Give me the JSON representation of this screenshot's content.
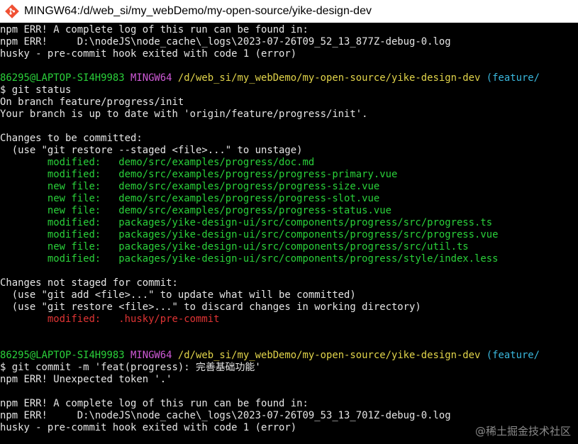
{
  "window": {
    "title": "MINGW64:/d/web_si/my_webDemo/my-open-source/yike-design-dev",
    "app_icon": "git-bash-icon",
    "colors": {
      "background": "#000000",
      "text": "#e6e6e6",
      "green": "#2ad13a",
      "magenta": "#d05ad8",
      "yellow": "#e1d44a",
      "cyan": "#3ab8de",
      "red": "#e03434"
    }
  },
  "terminal": {
    "lines": [
      {
        "segments": [
          {
            "text": "npm ERR! A complete log of this run can be found in:",
            "color": "default"
          }
        ]
      },
      {
        "segments": [
          {
            "text": "npm ERR!     D:\\nodeJS\\node_cache\\_logs\\2023-07-26T09_52_13_877Z-debug-0.log",
            "color": "default"
          }
        ]
      },
      {
        "segments": [
          {
            "text": "husky - pre-commit hook exited with code 1 (error)",
            "color": "default"
          }
        ]
      },
      {
        "segments": []
      },
      {
        "segments": [
          {
            "text": "86295@LAPTOP-SI4H9983 ",
            "color": "green"
          },
          {
            "text": "MINGW64 ",
            "color": "magenta"
          },
          {
            "text": "/d/web_si/my_webDemo/my-open-source/yike-design-dev ",
            "color": "yellow"
          },
          {
            "text": "(feature/",
            "color": "cyan"
          }
        ]
      },
      {
        "segments": [
          {
            "text": "$ git status",
            "color": "default"
          }
        ]
      },
      {
        "segments": [
          {
            "text": "On branch feature/progress/init",
            "color": "default"
          }
        ]
      },
      {
        "segments": [
          {
            "text": "Your branch is up to date with 'origin/feature/progress/init'.",
            "color": "default"
          }
        ]
      },
      {
        "segments": []
      },
      {
        "segments": [
          {
            "text": "Changes to be committed:",
            "color": "default"
          }
        ]
      },
      {
        "segments": [
          {
            "text": "  (use \"git restore --staged <file>...\" to unstage)",
            "color": "default"
          }
        ]
      },
      {
        "segments": [
          {
            "text": "        modified:   demo/src/examples/progress/doc.md",
            "color": "green"
          }
        ]
      },
      {
        "segments": [
          {
            "text": "        modified:   demo/src/examples/progress/progress-primary.vue",
            "color": "green"
          }
        ]
      },
      {
        "segments": [
          {
            "text": "        new file:   demo/src/examples/progress/progress-size.vue",
            "color": "green"
          }
        ]
      },
      {
        "segments": [
          {
            "text": "        new file:   demo/src/examples/progress/progress-slot.vue",
            "color": "green"
          }
        ]
      },
      {
        "segments": [
          {
            "text": "        new file:   demo/src/examples/progress/progress-status.vue",
            "color": "green"
          }
        ]
      },
      {
        "segments": [
          {
            "text": "        modified:   packages/yike-design-ui/src/components/progress/src/progress.ts",
            "color": "green"
          }
        ]
      },
      {
        "segments": [
          {
            "text": "        modified:   packages/yike-design-ui/src/components/progress/src/progress.vue",
            "color": "green"
          }
        ]
      },
      {
        "segments": [
          {
            "text": "        new file:   packages/yike-design-ui/src/components/progress/src/util.ts",
            "color": "green"
          }
        ]
      },
      {
        "segments": [
          {
            "text": "        modified:   packages/yike-design-ui/src/components/progress/style/index.less",
            "color": "green"
          }
        ]
      },
      {
        "segments": []
      },
      {
        "segments": [
          {
            "text": "Changes not staged for commit:",
            "color": "default"
          }
        ]
      },
      {
        "segments": [
          {
            "text": "  (use \"git add <file>...\" to update what will be committed)",
            "color": "default"
          }
        ]
      },
      {
        "segments": [
          {
            "text": "  (use \"git restore <file>...\" to discard changes in working directory)",
            "color": "default"
          }
        ]
      },
      {
        "segments": [
          {
            "text": "        modified:   .husky/pre-commit",
            "color": "red"
          }
        ]
      },
      {
        "segments": []
      },
      {
        "segments": []
      },
      {
        "segments": [
          {
            "text": "86295@LAPTOP-SI4H9983 ",
            "color": "green"
          },
          {
            "text": "MINGW64 ",
            "color": "magenta"
          },
          {
            "text": "/d/web_si/my_webDemo/my-open-source/yike-design-dev ",
            "color": "yellow"
          },
          {
            "text": "(feature/",
            "color": "cyan"
          }
        ]
      },
      {
        "segments": [
          {
            "text": "$ git commit -m 'feat(progress): 完善基础功能'",
            "color": "default"
          }
        ]
      },
      {
        "segments": [
          {
            "text": "npm ERR! Unexpected token '.'",
            "color": "default"
          }
        ]
      },
      {
        "segments": []
      },
      {
        "segments": [
          {
            "text": "npm ERR! A complete log of this run can be found in:",
            "color": "default"
          }
        ]
      },
      {
        "segments": [
          {
            "text": "npm ERR!     D:\\nodeJS\\node_cache\\_logs\\2023-07-26T09_53_13_701Z-debug-0.log",
            "color": "default"
          }
        ]
      },
      {
        "segments": [
          {
            "text": "husky - pre-commit hook exited with code 1 (error)",
            "color": "default"
          }
        ]
      }
    ]
  },
  "watermark": "@稀土掘金技术社区"
}
